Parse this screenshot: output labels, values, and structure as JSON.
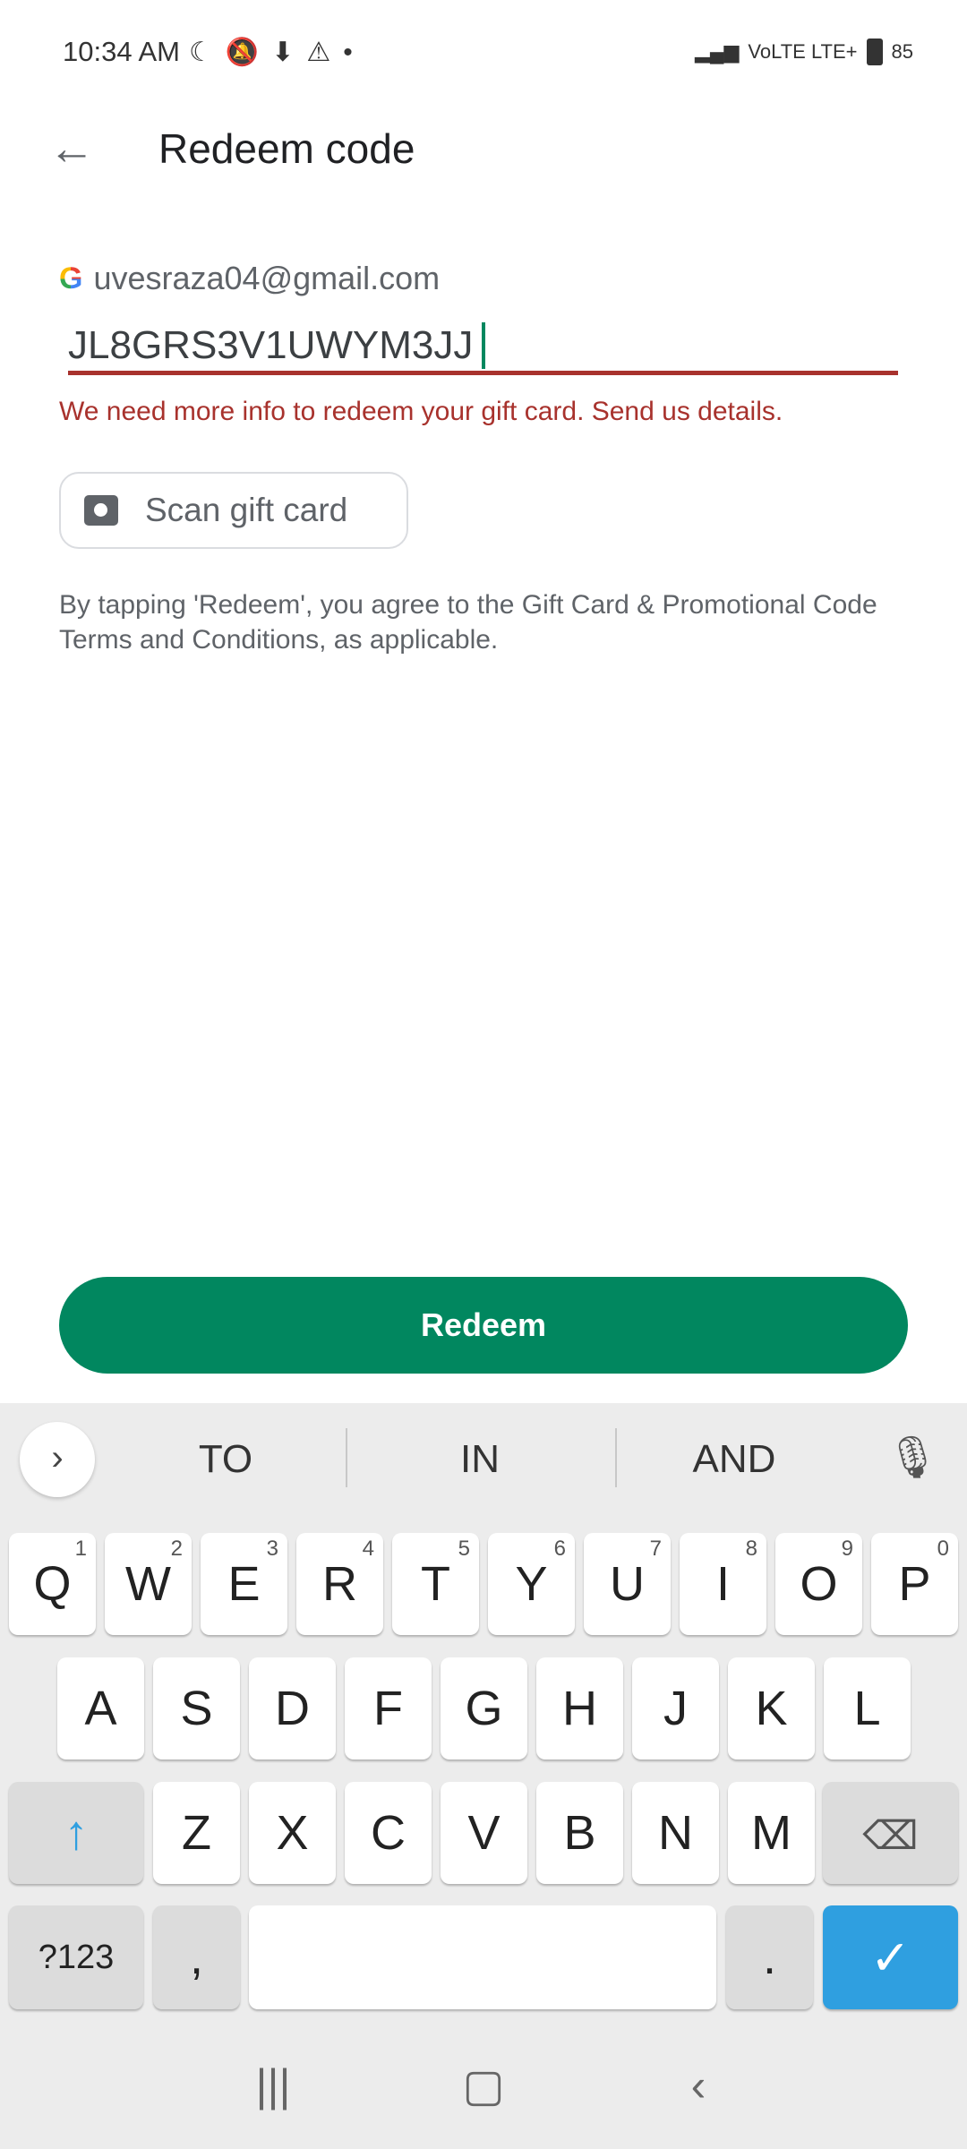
{
  "status": {
    "time": "10:34 AM",
    "icons": [
      "moon-icon",
      "bell-off-icon",
      "download-icon",
      "sync-alert-icon",
      "warning-icon",
      "dot-icon"
    ],
    "network": "VoLTE LTE+",
    "battery": "85"
  },
  "header": {
    "title": "Redeem code"
  },
  "account": {
    "email": "uvesraza04@gmail.com"
  },
  "code_input": {
    "value": "JL8GRS3V1UWYM3JJ"
  },
  "error": "We need more info to redeem your gift card. Send us details.",
  "scan_button": "Scan gift card",
  "terms": "By tapping 'Redeem', you agree to the Gift Card & Promotional Code Terms and Conditions, as applicable.",
  "redeem_button": "Redeem",
  "colors": {
    "accent": "#01875f",
    "error": "#a8322d",
    "enter": "#2f9fe0"
  },
  "keyboard": {
    "suggestions": [
      "TO",
      "IN",
      "AND"
    ],
    "row1": [
      {
        "k": "Q",
        "n": "1"
      },
      {
        "k": "W",
        "n": "2"
      },
      {
        "k": "E",
        "n": "3"
      },
      {
        "k": "R",
        "n": "4"
      },
      {
        "k": "T",
        "n": "5"
      },
      {
        "k": "Y",
        "n": "6"
      },
      {
        "k": "U",
        "n": "7"
      },
      {
        "k": "I",
        "n": "8"
      },
      {
        "k": "O",
        "n": "9"
      },
      {
        "k": "P",
        "n": "0"
      }
    ],
    "row2": [
      "A",
      "S",
      "D",
      "F",
      "G",
      "H",
      "J",
      "K",
      "L"
    ],
    "row3": [
      "Z",
      "X",
      "C",
      "V",
      "B",
      "N",
      "M"
    ],
    "symbols": "?123",
    "comma": ",",
    "period": "."
  }
}
